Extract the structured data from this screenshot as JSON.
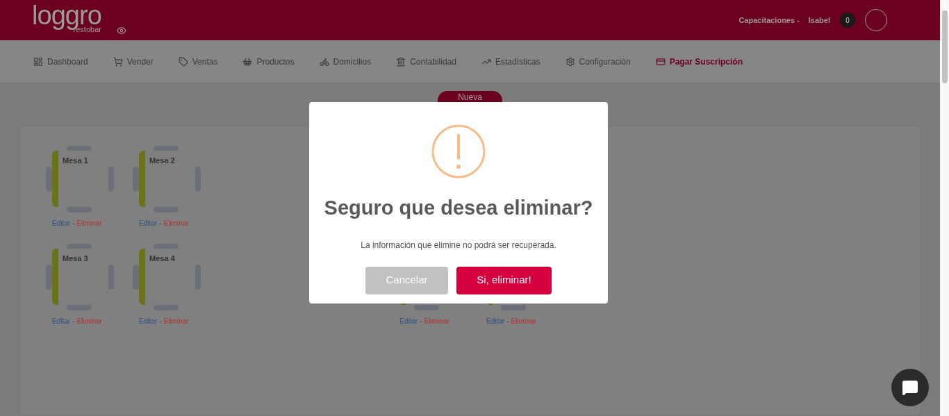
{
  "header": {
    "logo": {
      "word": "loggro",
      "sub": "restobar"
    },
    "company": "Capacitaciones -",
    "user": "Isabel",
    "notifications": "0"
  },
  "nav": [
    {
      "label": "Dashboard",
      "selected": false
    },
    {
      "label": "Vender",
      "selected": false
    },
    {
      "label": "Ventas",
      "selected": false
    },
    {
      "label": "Productos",
      "selected": false
    },
    {
      "label": "Domicilios",
      "selected": false
    },
    {
      "label": "Contabilidad",
      "selected": false
    },
    {
      "label": "Estadísticas",
      "selected": false
    },
    {
      "label": "Configuración",
      "selected": false
    },
    {
      "label": "Pagar Suscripción",
      "selected": true
    }
  ],
  "new_button": "Nueva",
  "floor": [
    [
      {
        "kind": "table",
        "name": "Mesa 1",
        "edit": "Editar",
        "separator": "-",
        "delete": "Eliminar",
        "color": "#6b7318"
      },
      {
        "kind": "table",
        "name": "Mesa 2",
        "edit": "Editar",
        "separator": "-",
        "delete": "Eliminar",
        "color": "#6b7318"
      }
    ],
    [
      {
        "kind": "table",
        "name": "Mesa 3",
        "edit": "Editar",
        "separator": "-",
        "delete": "Eliminar",
        "color": "#6b7318"
      },
      {
        "kind": "table",
        "name": "Mesa 4",
        "edit": "Editar",
        "separator": "-",
        "delete": "Eliminar",
        "color": "#6b7318"
      },
      {
        "kind": "empty"
      },
      {
        "kind": "empty"
      },
      {
        "kind": "table",
        "edit": "Editar",
        "separator": "-",
        "delete": "Eliminar",
        "color": "#6b7318"
      },
      {
        "kind": "table",
        "edit": "Editar",
        "separator": "-",
        "delete": "Eliminar",
        "color": "#6b7318"
      }
    ]
  ],
  "dialog": {
    "title": "Seguro que desea eliminar?",
    "message": "La información que elimine no podrá ser recuperada.",
    "cancel": "Cancelar",
    "confirm": "Si, eliminar!"
  }
}
